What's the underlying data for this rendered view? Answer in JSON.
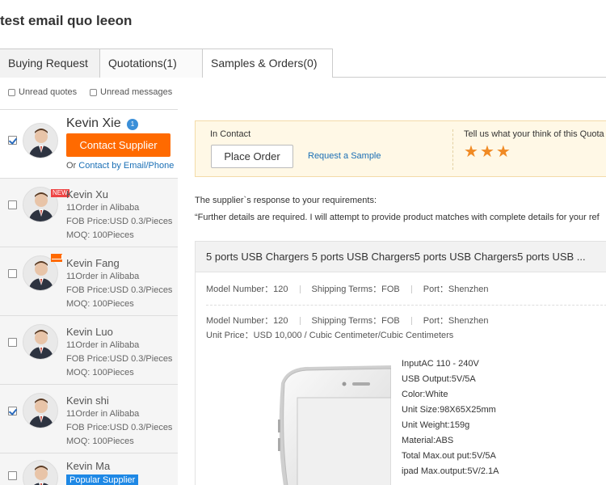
{
  "page_title": "test email quo leeon",
  "tabs": [
    "Buying Request",
    "Quotations(1)",
    "Samples & Orders(0)"
  ],
  "filters": [
    "Unread quotes",
    "Unread messages"
  ],
  "active_supplier": {
    "name": "Kevin Xie",
    "verified_badge": "1",
    "contact_button": "Contact Supplier",
    "or_prefix": "Or",
    "or_link": "Contact by Email/Phone"
  },
  "suppliers": [
    {
      "name": "Kevin Xu",
      "orders": "11Order in Alibaba",
      "fob": "FOB Price:USD 0.3/Pieces",
      "moq": "MOQ: 100Pieces",
      "badge": "NEW",
      "checked": false
    },
    {
      "name": "Kevin Fang",
      "orders": "11Order in Alibaba",
      "fob": "FOB Price:USD 0.3/Pieces",
      "moq": "MOQ: 100Pieces",
      "badge": "mail",
      "checked": false
    },
    {
      "name": "Kevin Luo",
      "orders": "11Order in Alibaba",
      "fob": "FOB Price:USD 0.3/Pieces",
      "moq": "MOQ: 100Pieces",
      "badge": "",
      "checked": false
    },
    {
      "name": "Kevin shi",
      "orders": "11Order in Alibaba",
      "fob": "FOB Price:USD 0.3/Pieces",
      "moq": "MOQ: 100Pieces",
      "badge": "",
      "checked": true
    },
    {
      "name": "Kevin Ma",
      "popular": "Popular Supplier",
      "checked": false
    }
  ],
  "in_contact": {
    "label": "In Contact",
    "place_order": "Place Order",
    "request_sample": "Request a Sample",
    "feedback": "Tell us what your think of this Quota",
    "stars": 3
  },
  "response": {
    "heading": "The supplier`s response to your requirements:",
    "text": "“Further details are required. I will attempt to provide product matches with complete details for your ref"
  },
  "product": {
    "title": "5 ports USB Chargers 5 ports USB Chargers5 ports USB Chargers5 ports USB ...",
    "spec_rows": [
      {
        "model": "Model Number：120",
        "shipping": "Shipping Terms：FOB",
        "port": "Port：Shenzhen"
      },
      {
        "model": "Model Number：120",
        "shipping": "Shipping Terms：FOB",
        "port": "Port：Shenzhen"
      }
    ],
    "unit_price": "Unit Price：USD 10,000 / Cubic Centimeter/Cubic Centimeters",
    "features": [
      "InputAC 110 - 240V",
      "USB Output:5V/5A",
      "Color:White",
      "Unit Size:98X65X25mm",
      "Unit Weight:159g",
      "Material:ABS",
      "Total Max.out put:5V/5A",
      "ipad Max.output:5V/2.1A"
    ]
  },
  "colors": {
    "accent": "#ff6a00",
    "link": "#1a6fb5",
    "popular": "#1e88e5",
    "star": "#f08a24"
  }
}
